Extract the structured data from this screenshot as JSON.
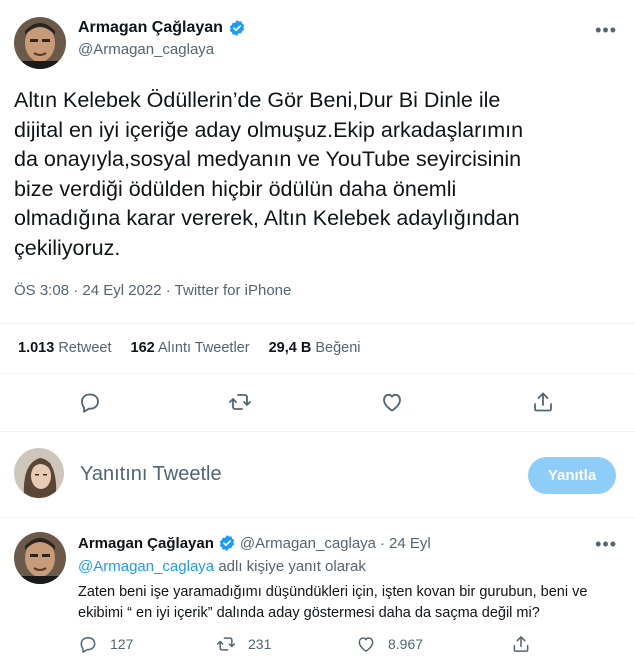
{
  "main_tweet": {
    "author_name": "Armagan Çağlayan",
    "author_handle": "@Armagan_caglaya",
    "more_icon": "more-horizontal-icon",
    "text": "Altın Kelebek Ödüllerin’de Gör Beni,Dur Bi Dinle ile\ndijital en iyi içeriğe aday olmuşuz.Ekip arkadaşlarımın\nda onayıyla,sosyal medyanın ve YouTube seyircisinin\nbize verdiği ödülden hiçbir ödülün daha önemli\nolmadığına karar vererek, Altın Kelebek adaylığından\nçekiliyoruz.",
    "meta": "ÖS 3:08 · 24 Eyl 2022 · Twitter for iPhone",
    "stats": [
      {
        "count": "1.013",
        "label": "Retweet"
      },
      {
        "count": "162",
        "label": "Alıntı Tweetler"
      },
      {
        "count": "29,4 B",
        "label": "Beğeni"
      }
    ],
    "actions": [
      "reply-icon",
      "retweet-icon",
      "like-icon",
      "share-icon"
    ]
  },
  "composer": {
    "placeholder": "Yanıtını Tweetle",
    "button_label": "Yanıtla"
  },
  "reply_tweet": {
    "author_name": "Armagan Çağlayan",
    "author_handle": "@Armagan_caglaya",
    "date": "24 Eyl",
    "separator": "·",
    "replying_mention": "@Armagan_caglaya",
    "replying_suffix": "adlı kişiye yanıt olarak",
    "text": "Zaten beni işe yaramadığımı düşündükleri için, işten kovan bir gurubun, beni ve ekibimi “ en iyi içerik” dalında aday göstermesi daha da saçma değil mi?",
    "reply_count": "127",
    "retweet_count": "231",
    "like_count": "8.967"
  },
  "colors": {
    "accent": "#1d9bf0",
    "button_disabled": "#8ecdf8",
    "secondary_text": "#536471"
  }
}
